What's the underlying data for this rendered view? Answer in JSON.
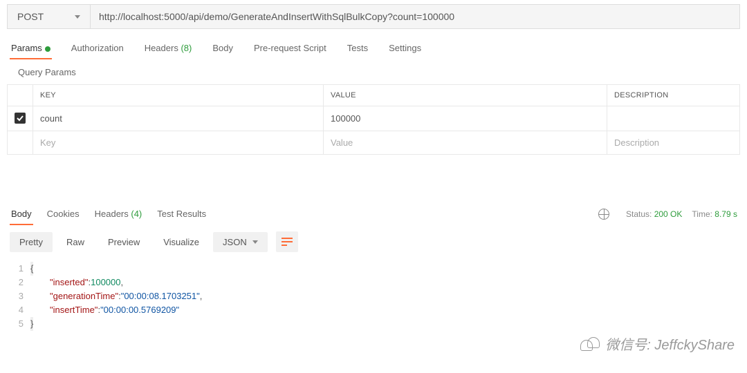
{
  "request": {
    "method": "POST",
    "url": "http://localhost:5000/api/demo/GenerateAndInsertWithSqlBulkCopy?count=100000"
  },
  "reqTabs": {
    "params": "Params",
    "auth": "Authorization",
    "headers": "Headers",
    "headersCount": "(8)",
    "body": "Body",
    "prereq": "Pre-request Script",
    "tests": "Tests",
    "settings": "Settings"
  },
  "queryParams": {
    "title": "Query Params",
    "headers": {
      "key": "KEY",
      "value": "VALUE",
      "desc": "DESCRIPTION"
    },
    "rows": [
      {
        "enabled": true,
        "key": "count",
        "value": "100000",
        "desc": ""
      }
    ],
    "placeholders": {
      "key": "Key",
      "value": "Value",
      "desc": "Description"
    }
  },
  "respTabs": {
    "body": "Body",
    "cookies": "Cookies",
    "headers": "Headers",
    "headersCount": "(4)",
    "testResults": "Test Results"
  },
  "status": {
    "statusLabel": "Status:",
    "statusValue": "200 OK",
    "timeLabel": "Time:",
    "timeValue": "8.79 s"
  },
  "viewBar": {
    "pretty": "Pretty",
    "raw": "Raw",
    "preview": "Preview",
    "visualize": "Visualize",
    "format": "JSON"
  },
  "response": {
    "inserted_key": "\"inserted\"",
    "inserted_val": "100000",
    "gen_key": "\"generationTime\"",
    "gen_val": "\"00:00:08.1703251\"",
    "ins_key": "\"insertTime\"",
    "ins_val": "\"00:00:00.5769209\""
  },
  "watermark": "微信号: JeffckyShare"
}
